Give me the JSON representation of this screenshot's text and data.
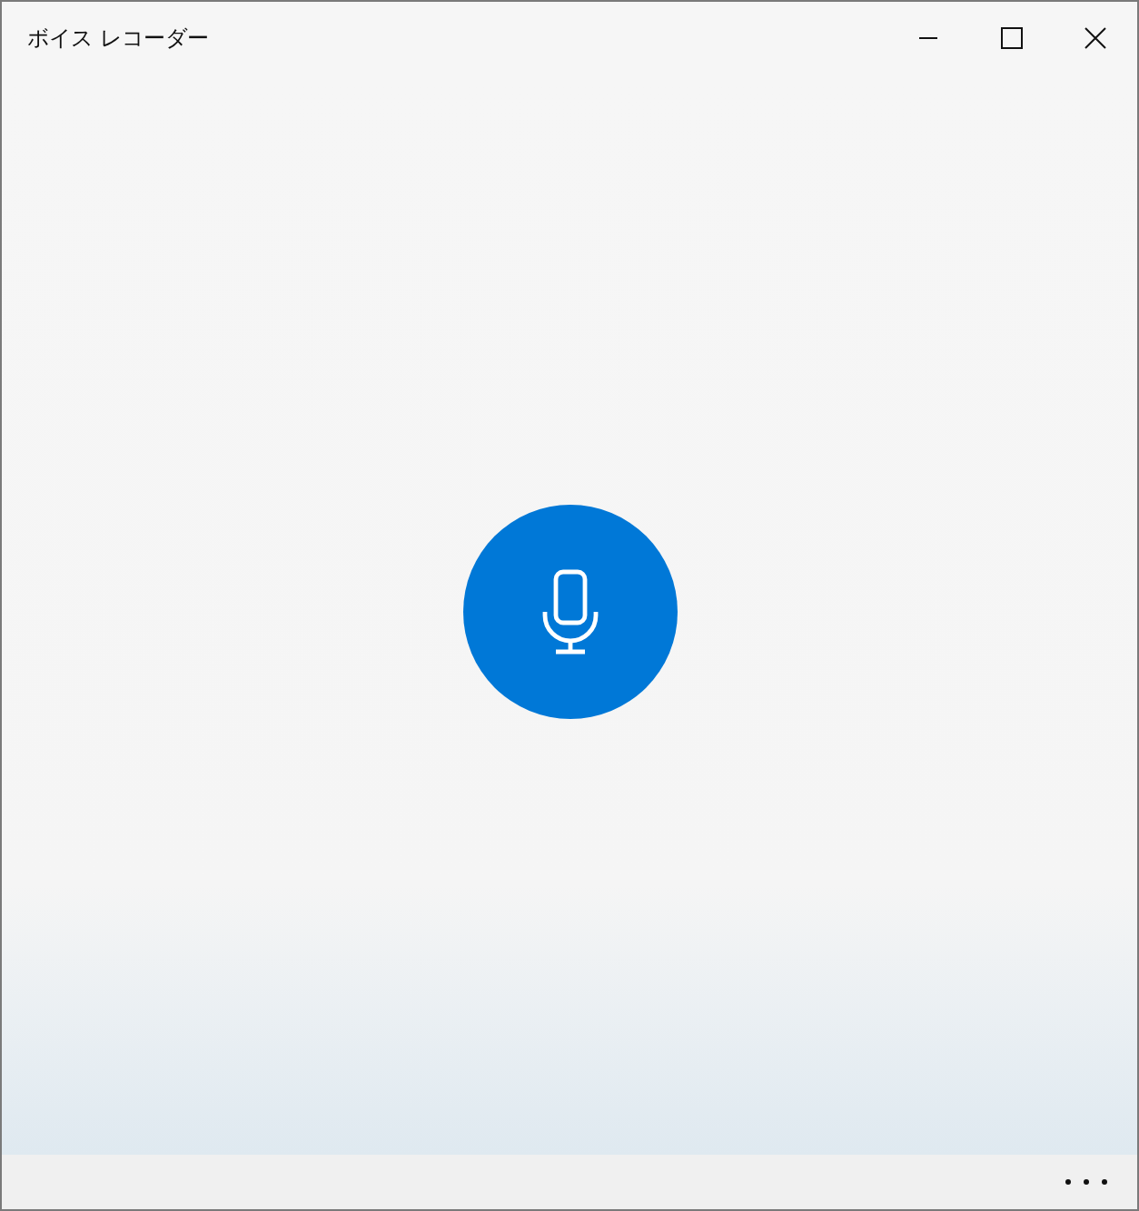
{
  "window": {
    "title": "ボイス レコーダー"
  }
}
